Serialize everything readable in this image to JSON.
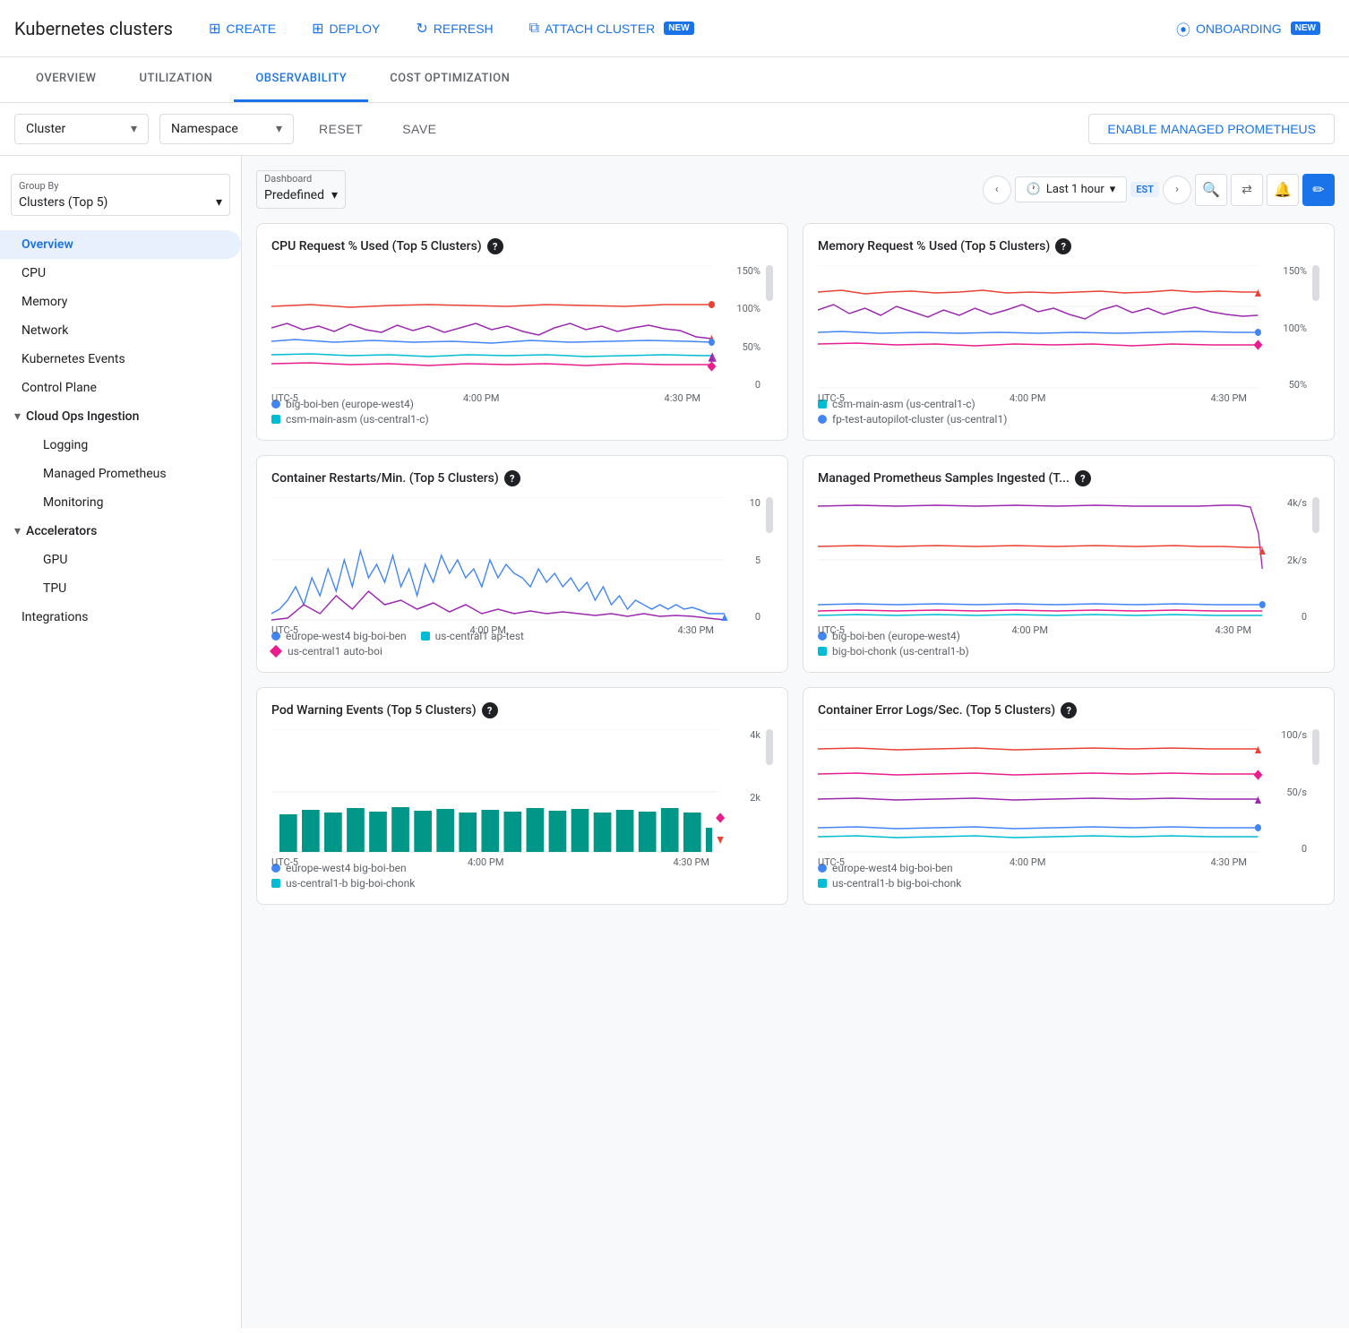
{
  "header": {
    "title": "Kubernetes clusters",
    "buttons": {
      "create": "CREATE",
      "deploy": "DEPLOY",
      "refresh": "REFRESH",
      "attach_cluster": "ATTACH CLUSTER",
      "onboarding": "ONBOARDING"
    },
    "new_badges": [
      "attach_cluster",
      "onboarding"
    ]
  },
  "tabs": {
    "items": [
      "OVERVIEW",
      "UTILIZATION",
      "OBSERVABILITY",
      "COST OPTIMIZATION"
    ],
    "active": "OBSERVABILITY"
  },
  "filters": {
    "cluster_placeholder": "Cluster",
    "namespace_placeholder": "Namespace",
    "reset": "RESET",
    "save": "SAVE",
    "enable_prometheus": "ENABLE MANAGED PROMETHEUS"
  },
  "sidebar": {
    "group_by_label": "Group By",
    "group_by_value": "Clusters (Top 5)",
    "nav_items": [
      {
        "id": "overview",
        "label": "Overview",
        "active": true,
        "indent": 1
      },
      {
        "id": "cpu",
        "label": "CPU",
        "active": false,
        "indent": 1
      },
      {
        "id": "memory",
        "label": "Memory",
        "active": false,
        "indent": 1
      },
      {
        "id": "network",
        "label": "Network",
        "active": false,
        "indent": 1
      },
      {
        "id": "kubernetes-events",
        "label": "Kubernetes Events",
        "active": false,
        "indent": 1
      },
      {
        "id": "control-plane",
        "label": "Control Plane",
        "active": false,
        "indent": 1
      },
      {
        "id": "cloud-ops-ingestion",
        "label": "Cloud Ops Ingestion",
        "active": false,
        "indent": 0,
        "expandable": true,
        "expanded": true
      },
      {
        "id": "logging",
        "label": "Logging",
        "active": false,
        "indent": 2
      },
      {
        "id": "managed-prometheus",
        "label": "Managed Prometheus",
        "active": false,
        "indent": 2
      },
      {
        "id": "monitoring",
        "label": "Monitoring",
        "active": false,
        "indent": 2
      },
      {
        "id": "accelerators",
        "label": "Accelerators",
        "active": false,
        "indent": 0,
        "expandable": true,
        "expanded": true
      },
      {
        "id": "gpu",
        "label": "GPU",
        "active": false,
        "indent": 2
      },
      {
        "id": "tpu",
        "label": "TPU",
        "active": false,
        "indent": 2
      },
      {
        "id": "integrations",
        "label": "Integrations",
        "active": false,
        "indent": 1
      }
    ]
  },
  "dashboard": {
    "label": "Dashboard",
    "value": "Predefined",
    "time_range": "Last 1 hour",
    "timezone": "EST"
  },
  "charts": [
    {
      "id": "cpu-request",
      "title": "CPU Request % Used (Top 5 Clusters)",
      "y_labels": [
        "150%",
        "100%",
        "50%",
        "0"
      ],
      "x_labels": [
        "UTC-5",
        "4:00 PM",
        "4:30 PM"
      ],
      "legend": [
        {
          "type": "dot",
          "color": "#4285f4",
          "label": "big-boi-ben (europe-west4)"
        },
        {
          "type": "sq",
          "color": "#00bcd4",
          "label": "csm-main-asm (us-central1-c)"
        }
      ]
    },
    {
      "id": "memory-request",
      "title": "Memory Request % Used (Top 5 Clusters)",
      "y_labels": [
        "150%",
        "100%",
        "50%"
      ],
      "x_labels": [
        "UTC-5",
        "4:00 PM",
        "4:30 PM"
      ],
      "legend": [
        {
          "type": "sq",
          "color": "#00bcd4",
          "label": "csm-main-asm (us-central1-c)"
        },
        {
          "type": "dot",
          "color": "#4285f4",
          "label": "fp-test-autopilot-cluster (us-central1)"
        }
      ]
    },
    {
      "id": "container-restarts",
      "title": "Container Restarts/Min. (Top 5 Clusters)",
      "y_labels": [
        "10",
        "5",
        "0"
      ],
      "x_labels": [
        "UTC-5",
        "4:00 PM",
        "4:30 PM"
      ],
      "legend": [
        {
          "type": "dot",
          "color": "#4285f4",
          "label": "europe-west4 big-boi-ben"
        },
        {
          "type": "sq",
          "color": "#00bcd4",
          "label": "us-central1 ap-test"
        },
        {
          "type": "diamond",
          "color": "#e91e8c",
          "label": "us-central1 auto-boi"
        }
      ]
    },
    {
      "id": "managed-prometheus",
      "title": "Managed Prometheus Samples Ingested (T...",
      "y_labels": [
        "4k/s",
        "2k/s",
        "0"
      ],
      "x_labels": [
        "UTC-5",
        "4:00 PM",
        "4:30 PM"
      ],
      "legend": [
        {
          "type": "dot",
          "color": "#4285f4",
          "label": "big-boi-ben (europe-west4)"
        },
        {
          "type": "sq",
          "color": "#00bcd4",
          "label": "big-boi-chonk (us-central1-b)"
        }
      ]
    },
    {
      "id": "pod-warning",
      "title": "Pod Warning Events (Top 5 Clusters)",
      "y_labels": [
        "4k",
        "2k",
        ""
      ],
      "x_labels": [
        "UTC-5",
        "4:00 PM",
        "4:30 PM"
      ],
      "legend": [
        {
          "type": "dot",
          "color": "#4285f4",
          "label": "europe-west4 big-boi-ben"
        },
        {
          "type": "sq",
          "color": "#00bcd4",
          "label": "us-central1-b big-boi-chonk"
        }
      ]
    },
    {
      "id": "container-error",
      "title": "Container Error Logs/Sec. (Top 5 Clusters)",
      "y_labels": [
        "100/s",
        "50/s",
        "0"
      ],
      "x_labels": [
        "UTC-5",
        "4:00 PM",
        "4:30 PM"
      ],
      "legend": [
        {
          "type": "dot",
          "color": "#4285f4",
          "label": "europe-west4 big-boi-ben"
        },
        {
          "type": "sq",
          "color": "#00bcd4",
          "label": "us-central1-b big-boi-chonk"
        }
      ]
    }
  ]
}
